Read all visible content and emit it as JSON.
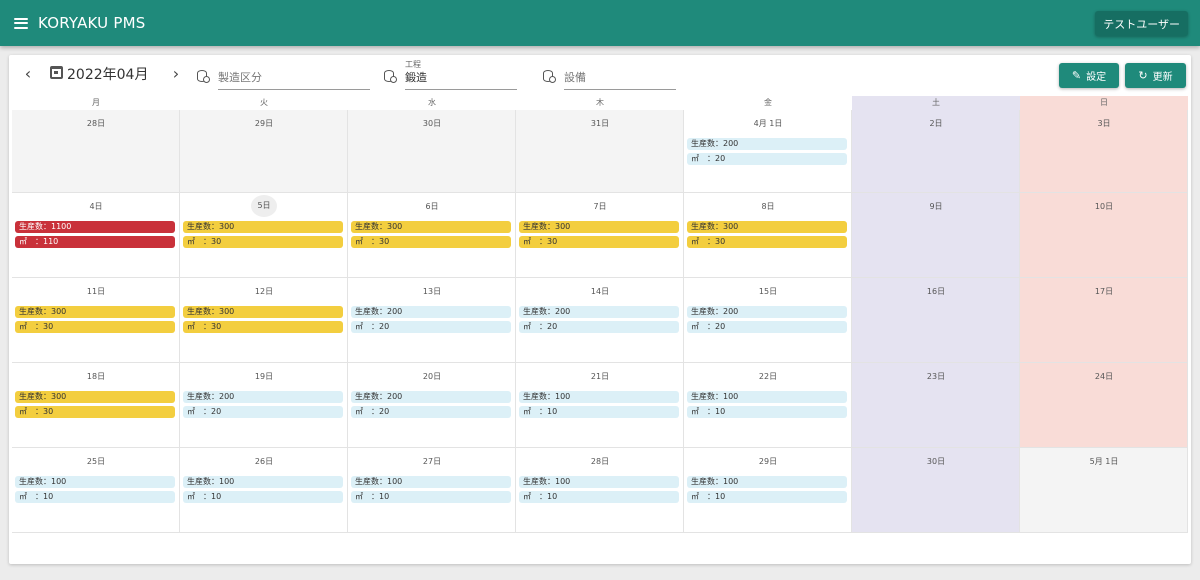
{
  "app": {
    "title": "KORYAKU PMS",
    "user_label": "テストユーザー",
    "accent_color": "#1f8a7b"
  },
  "toolbar": {
    "prev_icon": "chevron-left-icon",
    "next_icon": "chevron-right-icon",
    "prev_glyph": "‹",
    "next_glyph": "›",
    "month_label": "2022年04月",
    "filters": [
      {
        "label": "",
        "value": "",
        "placeholder": "製造区分"
      },
      {
        "label": "工程",
        "value": "鍛造",
        "placeholder": ""
      },
      {
        "label": "",
        "value": "",
        "placeholder": "設備"
      }
    ],
    "settings_label": "設定",
    "settings_glyph": "✎",
    "refresh_label": "更新",
    "refresh_glyph": "↻"
  },
  "calendar": {
    "weekdays": [
      "月",
      "火",
      "水",
      "木",
      "金",
      "土",
      "日"
    ],
    "event_colors": {
      "blue": "#dcf0f7",
      "yellow": "#f3ce3f",
      "red": "#c9313a"
    },
    "weeks": [
      [
        {
          "label": "28日",
          "type": "other",
          "events": []
        },
        {
          "label": "29日",
          "type": "other",
          "events": []
        },
        {
          "label": "30日",
          "type": "other",
          "events": []
        },
        {
          "label": "31日",
          "type": "other",
          "events": []
        },
        {
          "label": "4月 1日",
          "type": "normal",
          "events": [
            {
              "prod": "生産数：200",
              "area": "㎡　：20",
              "color": "blue"
            }
          ]
        },
        {
          "label": "2日",
          "type": "sat",
          "events": []
        },
        {
          "label": "3日",
          "type": "sun",
          "events": []
        }
      ],
      [
        {
          "label": "4日",
          "type": "normal",
          "events": [
            {
              "prod": "生産数：1100",
              "area": "㎡　：110",
              "color": "red"
            }
          ]
        },
        {
          "label": "5日",
          "type": "today",
          "events": [
            {
              "prod": "生産数：300",
              "area": "㎡　：30",
              "color": "yellow"
            }
          ]
        },
        {
          "label": "6日",
          "type": "normal",
          "events": [
            {
              "prod": "生産数：300",
              "area": "㎡　：30",
              "color": "yellow"
            }
          ]
        },
        {
          "label": "7日",
          "type": "normal",
          "events": [
            {
              "prod": "生産数：300",
              "area": "㎡　：30",
              "color": "yellow"
            }
          ]
        },
        {
          "label": "8日",
          "type": "normal",
          "events": [
            {
              "prod": "生産数：300",
              "area": "㎡　：30",
              "color": "yellow"
            }
          ]
        },
        {
          "label": "9日",
          "type": "sat",
          "events": []
        },
        {
          "label": "10日",
          "type": "sun",
          "events": []
        }
      ],
      [
        {
          "label": "11日",
          "type": "normal",
          "events": [
            {
              "prod": "生産数：300",
              "area": "㎡　：30",
              "color": "yellow"
            }
          ]
        },
        {
          "label": "12日",
          "type": "normal",
          "events": [
            {
              "prod": "生産数：300",
              "area": "㎡　：30",
              "color": "yellow"
            }
          ]
        },
        {
          "label": "13日",
          "type": "normal",
          "events": [
            {
              "prod": "生産数：200",
              "area": "㎡　：20",
              "color": "blue"
            }
          ]
        },
        {
          "label": "14日",
          "type": "normal",
          "events": [
            {
              "prod": "生産数：200",
              "area": "㎡　：20",
              "color": "blue"
            }
          ]
        },
        {
          "label": "15日",
          "type": "normal",
          "events": [
            {
              "prod": "生産数：200",
              "area": "㎡　：20",
              "color": "blue"
            }
          ]
        },
        {
          "label": "16日",
          "type": "sat",
          "events": []
        },
        {
          "label": "17日",
          "type": "sun",
          "events": []
        }
      ],
      [
        {
          "label": "18日",
          "type": "normal",
          "events": [
            {
              "prod": "生産数：300",
              "area": "㎡　：30",
              "color": "yellow"
            }
          ]
        },
        {
          "label": "19日",
          "type": "normal",
          "events": [
            {
              "prod": "生産数：200",
              "area": "㎡　：20",
              "color": "blue"
            }
          ]
        },
        {
          "label": "20日",
          "type": "normal",
          "events": [
            {
              "prod": "生産数：200",
              "area": "㎡　：20",
              "color": "blue"
            }
          ]
        },
        {
          "label": "21日",
          "type": "normal",
          "events": [
            {
              "prod": "生産数：100",
              "area": "㎡　：10",
              "color": "blue"
            }
          ]
        },
        {
          "label": "22日",
          "type": "normal",
          "events": [
            {
              "prod": "生産数：100",
              "area": "㎡　：10",
              "color": "blue"
            }
          ]
        },
        {
          "label": "23日",
          "type": "sat",
          "events": []
        },
        {
          "label": "24日",
          "type": "sun",
          "events": []
        }
      ],
      [
        {
          "label": "25日",
          "type": "normal",
          "events": [
            {
              "prod": "生産数：100",
              "area": "㎡　：10",
              "color": "blue"
            }
          ]
        },
        {
          "label": "26日",
          "type": "normal",
          "events": [
            {
              "prod": "生産数：100",
              "area": "㎡　：10",
              "color": "blue"
            }
          ]
        },
        {
          "label": "27日",
          "type": "normal",
          "events": [
            {
              "prod": "生産数：100",
              "area": "㎡　：10",
              "color": "blue"
            }
          ]
        },
        {
          "label": "28日",
          "type": "normal",
          "events": [
            {
              "prod": "生産数：100",
              "area": "㎡　：10",
              "color": "blue"
            }
          ]
        },
        {
          "label": "29日",
          "type": "normal",
          "events": [
            {
              "prod": "生産数：100",
              "area": "㎡　：10",
              "color": "blue"
            }
          ]
        },
        {
          "label": "30日",
          "type": "sat",
          "events": []
        },
        {
          "label": "5月 1日",
          "type": "other",
          "events": []
        }
      ]
    ]
  }
}
